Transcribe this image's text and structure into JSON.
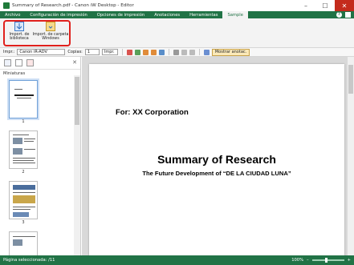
{
  "window": {
    "title": "Summary of Research.pdf - Canon iW Desktop - Editor",
    "controls": {
      "minimize": "–",
      "maximize": "☐",
      "close": "✕"
    }
  },
  "ribbon": {
    "tabs": [
      {
        "label": "Archivo",
        "active": false
      },
      {
        "label": "Configuración de impresión",
        "active": false
      },
      {
        "label": "Opciones de impresión",
        "active": false
      },
      {
        "label": "Anotaciones",
        "active": false
      },
      {
        "label": "Herramientas",
        "active": false
      },
      {
        "label": "Sample",
        "active": true
      }
    ],
    "help_icon": "?",
    "buttons": [
      {
        "label_line1": "Import. de",
        "label_line2": "biblioteca",
        "icon": "import-library-icon"
      },
      {
        "label_line1": "Import. de carpeta",
        "label_line2": "Windows",
        "icon": "import-folder-icon"
      }
    ],
    "highlight_color": "#e0201c"
  },
  "toolbar": {
    "printer_label": "Impr.:",
    "printer_value": "Canon iR-ADV",
    "copies_label": "Copias:",
    "copies_value": "1",
    "print_button": "Impr.",
    "show_annotations": "Mostrar anotac."
  },
  "left_pane": {
    "label": "Miniaturas",
    "close": "✕",
    "thumbnails": [
      {
        "page": "1"
      },
      {
        "page": "2"
      },
      {
        "page": "3"
      }
    ]
  },
  "document": {
    "for_line": "For: XX Corporation",
    "title": "Summary of Research",
    "subtitle": "The Future Development of “DE LA CIUDAD LUNA”"
  },
  "status": {
    "selected_page": "Página seleccionada: /11",
    "zoom": "100%",
    "zoom_minus": "–",
    "zoom_plus": "+"
  },
  "colors": {
    "accent": "#217346",
    "highlight": "#e0201c"
  }
}
